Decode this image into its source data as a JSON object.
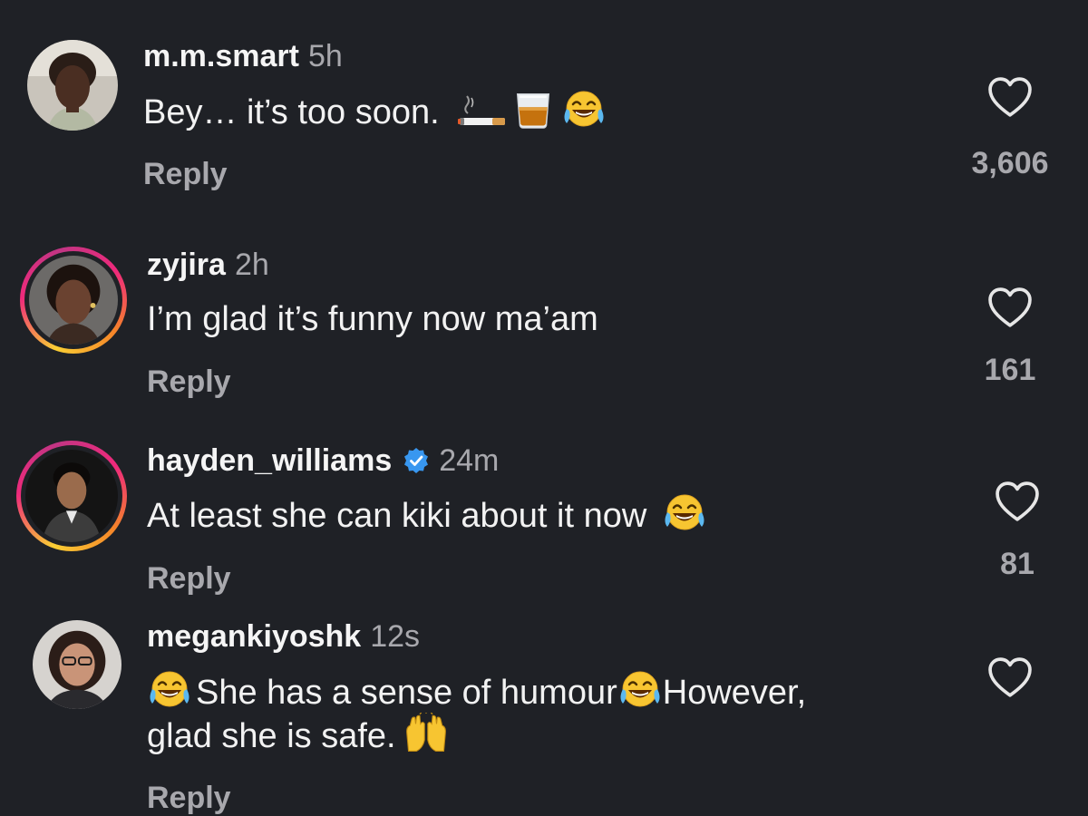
{
  "comments": [
    {
      "username": "m.m.smart",
      "time": "5h",
      "text": "Bey… it’s too soon.",
      "reply_label": "Reply",
      "likes": "3,606",
      "has_story": false,
      "verified": false
    },
    {
      "username": "zyjira",
      "time": "2h",
      "text": "I’m glad it’s funny now ma’am",
      "reply_label": "Reply",
      "likes": "161",
      "has_story": true,
      "verified": false
    },
    {
      "username": "hayden_williams",
      "time": "24m",
      "text": "At least she can kiki about it now",
      "reply_label": "Reply",
      "likes": "81",
      "has_story": true,
      "verified": true
    },
    {
      "username": "megankiyoshk",
      "time": "12s",
      "text_part1": "She has a sense of humour",
      "text_part2": "However,",
      "text_line2": "glad she is safe.",
      "reply_label": "Reply",
      "likes": "",
      "has_story": false,
      "verified": false
    }
  ],
  "icons": {
    "like": "heart-outline-icon",
    "verified": "verified-badge-icon",
    "emoji_laugh": "face-with-tears-of-joy",
    "emoji_cigarette": "cigarette",
    "emoji_whisky": "tumbler-glass",
    "emoji_raised_hands": "raising-hands"
  },
  "colors": {
    "background": "#1f2126",
    "muted_text": "#a8a8ad",
    "verified_blue": "#3897f0"
  }
}
